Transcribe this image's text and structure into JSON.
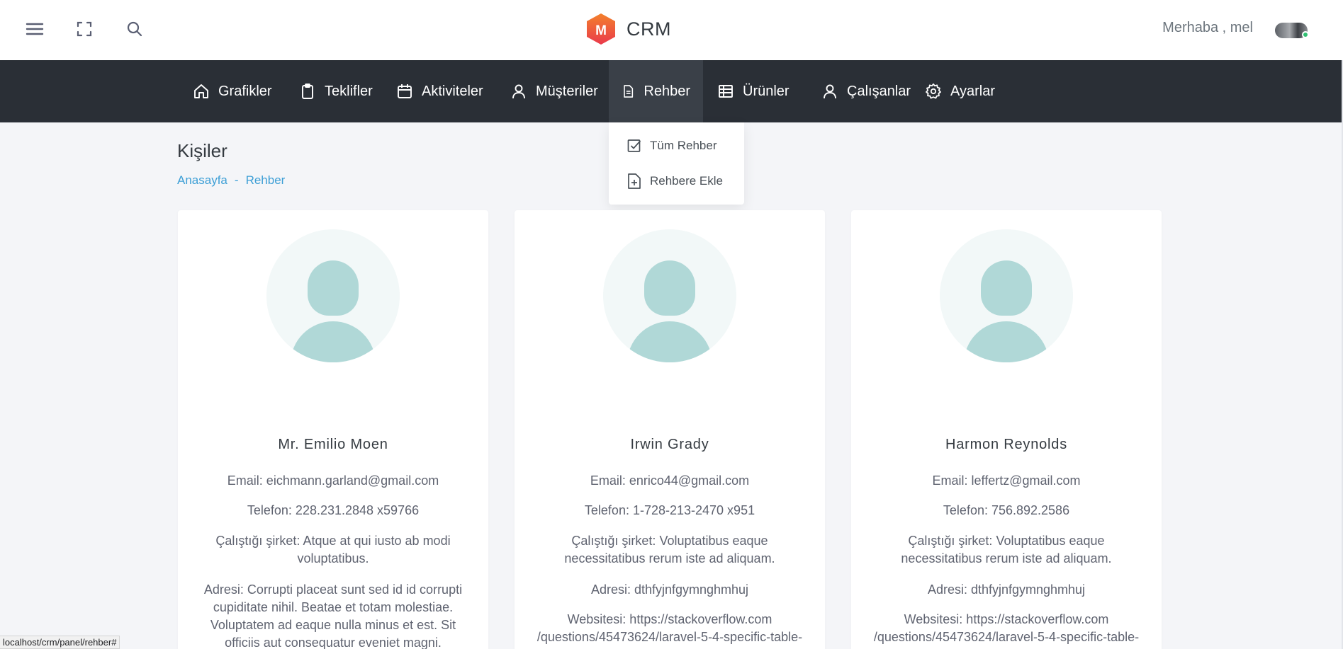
{
  "header": {
    "brand_letter": "M",
    "brand_name": "CRM",
    "greeting": "Merhaba , mel"
  },
  "nav": {
    "items": [
      {
        "label": "Grafikler",
        "icon": "home-icon"
      },
      {
        "label": "Teklifler",
        "icon": "clipboard-icon"
      },
      {
        "label": "Aktiviteler",
        "icon": "calendar-icon"
      },
      {
        "label": "Müşteriler",
        "icon": "user-icon"
      },
      {
        "label": "Rehber",
        "icon": "document-icon",
        "active": true
      },
      {
        "label": "Ürünler",
        "icon": "table-icon"
      },
      {
        "label": "Çalışanlar",
        "icon": "user-icon"
      },
      {
        "label": "Ayarlar",
        "icon": "gear-icon"
      }
    ]
  },
  "dropdown": {
    "items": [
      {
        "label": "Tüm Rehber",
        "icon": "checkbox-icon"
      },
      {
        "label": "Rehbere Ekle",
        "icon": "file-plus-icon"
      }
    ]
  },
  "page": {
    "title": "Kişiler",
    "breadcrumb": {
      "home": "Anasayfa",
      "separator": "-",
      "current": "Rehber"
    }
  },
  "cards": [
    {
      "name": "Mr. Emilio Moen",
      "email": "Email: eichmann.garland@gmail.com",
      "phone": "Telefon: 228.231.2848 x59766",
      "company": "Çalıştığı şirket: Atque at qui iusto ab modi voluptatibus.",
      "address": "Adresi: Corrupti placeat sunt sed id id corrupti cupiditate nihil. Beatae et totam molestiae. Voluptatem ad eaque nulla minus et est. Sit officiis aut consequatur eveniet magni."
    },
    {
      "name": "Irwin Grady",
      "email": "Email: enrico44@gmail.com",
      "phone": "Telefon: 1-728-213-2470 x951",
      "company": "Çalıştığı şirket: Voluptatibus eaque necessitatibus rerum iste ad aliquam.",
      "address": "Adresi: dthfyjnfgymnghmhuj",
      "website": "Websitesi: https://stackoverflow.com /questions/45473624/laravel-5-4-specific-table-"
    },
    {
      "name": "Harmon Reynolds",
      "email": "Email: leffertz@gmail.com",
      "phone": "Telefon: 756.892.2586",
      "company": "Çalıştığı şirket: Voluptatibus eaque necessitatibus rerum iste ad aliquam.",
      "address": "Adresi: dthfyjnfgymnghmhuj",
      "website": "Websitesi: https://stackoverflow.com /questions/45473624/laravel-5-4-specific-table-"
    }
  ],
  "statusbar": {
    "url": "localhost/crm/panel/rehber#"
  },
  "colors": {
    "navbar": "#2a2f36",
    "accent_link": "#3d9fd6",
    "avatar_fill": "#b0d8d7",
    "brand_logo": "#f0533d"
  }
}
